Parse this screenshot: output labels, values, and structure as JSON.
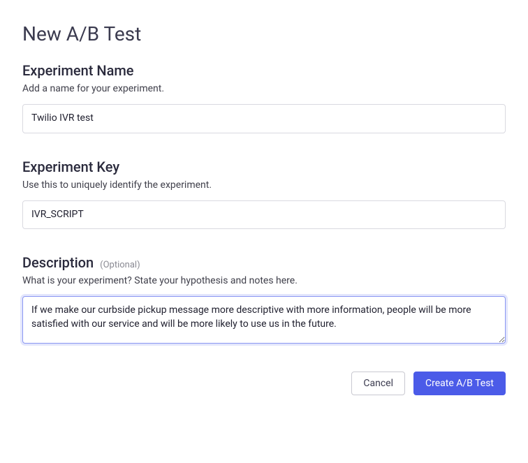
{
  "page": {
    "title": "New A/B Test"
  },
  "sections": {
    "name": {
      "heading": "Experiment Name",
      "subtext": "Add a name for your experiment.",
      "value": "Twilio IVR test"
    },
    "key": {
      "heading": "Experiment Key",
      "subtext": "Use this to uniquely identify the experiment.",
      "value": "IVR_SCRIPT"
    },
    "description": {
      "heading": "Description",
      "optional_label": "(Optional)",
      "subtext": "What is your experiment? State your hypothesis and notes here.",
      "value": "If we make our curbside pickup message more descriptive with more information, people will be more satisfied with our service and will be more likely to use us in the future."
    }
  },
  "buttons": {
    "cancel": "Cancel",
    "create": "Create A/B Test"
  }
}
